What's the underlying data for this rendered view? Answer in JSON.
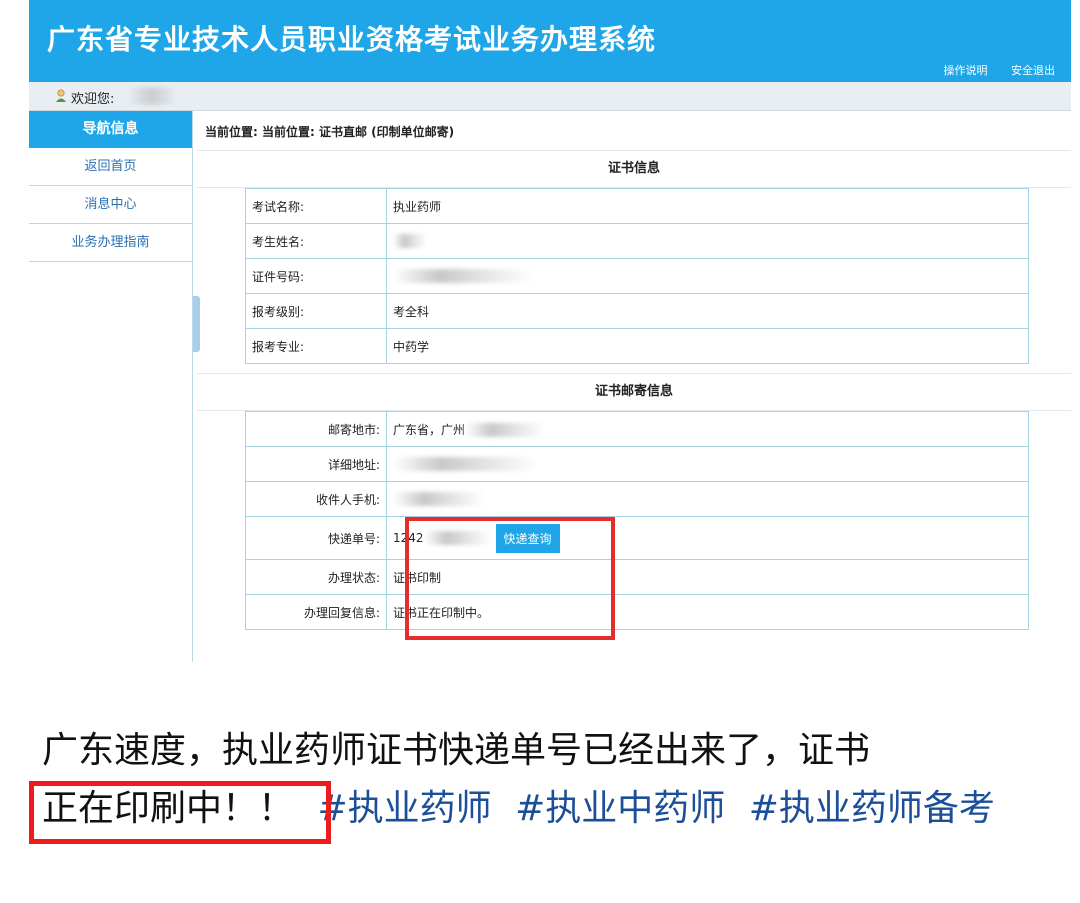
{
  "header": {
    "title": "广东省专业技术人员职业资格考试业务办理系统",
    "links": [
      "操作说明",
      "安全退出"
    ]
  },
  "welcome": {
    "label": "欢迎您:"
  },
  "sidebar": {
    "heading": "导航信息",
    "items": [
      "返回首页",
      "消息中心",
      "业务办理指南"
    ]
  },
  "breadcrumb": "当前位置: 当前位置: 证书直邮 (印制单位邮寄)",
  "cert_info": {
    "title": "证书信息",
    "rows": [
      {
        "label": "考试名称:",
        "value": "执业药师"
      },
      {
        "label": "考生姓名:",
        "value": ""
      },
      {
        "label": "证件号码:",
        "value": ""
      },
      {
        "label": "报考级别:",
        "value": "考全科"
      },
      {
        "label": "报考专业:",
        "value": "中药学"
      }
    ]
  },
  "mail_info": {
    "title": "证书邮寄信息",
    "rows": [
      {
        "label": "邮寄地市:",
        "value": "广东省，广州"
      },
      {
        "label": "详细地址:",
        "value": ""
      },
      {
        "label": "收件人手机:",
        "value": ""
      },
      {
        "label": "快递单号:",
        "value": "1242"
      },
      {
        "label": "办理状态:",
        "value": "证书印制"
      },
      {
        "label": "办理回复信息:",
        "value": "证书正在印制中。"
      }
    ],
    "query_button": "快递查询"
  },
  "caption": {
    "line1": "广东速度，执业药师证书快递单号已经出来了，证书",
    "highlight": "正在印刷中！！",
    "tags": [
      "#执业药师",
      "#执业中药师",
      "#执业药师备考"
    ]
  },
  "colors": {
    "brand": "#1fa6e8",
    "highlight_border": "#e62d2d",
    "tag": "#1d4f99"
  }
}
